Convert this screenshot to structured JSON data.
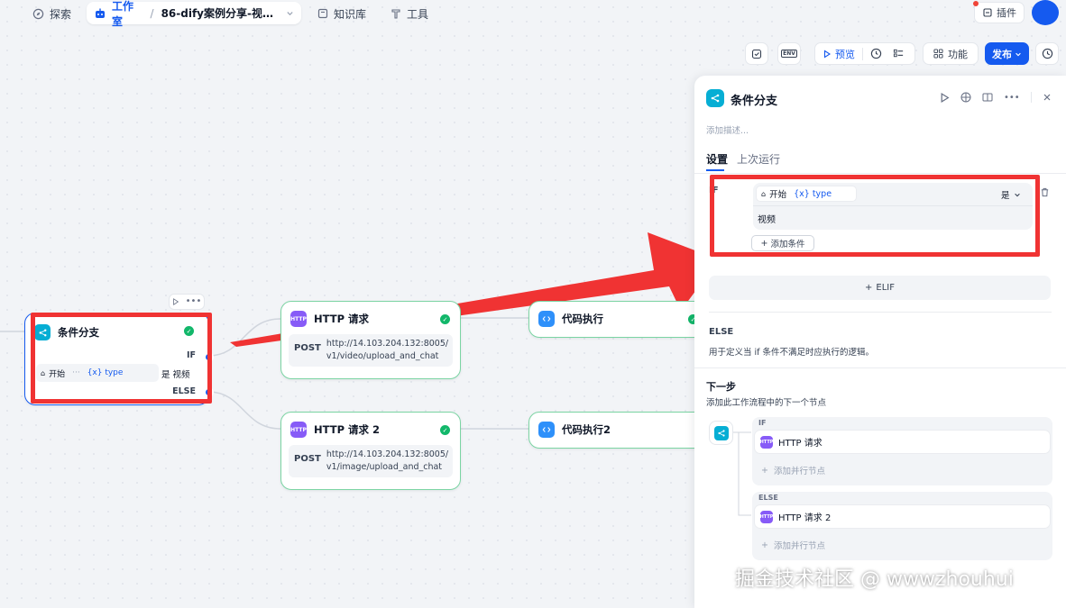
{
  "topbar": {
    "explore": "探索",
    "studio": "工作室",
    "app_name": "86-dify案例分享-视频...",
    "knowledge": "知识库",
    "tools": "工具",
    "plugins": "插件"
  },
  "toolbar": {
    "preview": "预览",
    "features": "功能",
    "publish": "发布",
    "env_label": "ENV"
  },
  "canvas": {
    "if_node": {
      "title": "条件分支",
      "if_label": "IF",
      "else_label": "ELSE",
      "cond_source": "开始",
      "cond_var": "{x} type",
      "cond_op": "是",
      "cond_value": "视频"
    },
    "http1": {
      "title": "HTTP 请求",
      "method": "POST",
      "url_line1": "http://14.103.204.132:8005/",
      "url_line2": "v1/video/upload_and_chat"
    },
    "http2": {
      "title": "HTTP 请求 2",
      "method": "POST",
      "url_line1": "http://14.103.204.132:8005/",
      "url_line2": "v1/image/upload_and_chat"
    },
    "code1": {
      "title": "代码执行"
    },
    "code2": {
      "title": "代码执行2"
    },
    "http_badge": "HTTP"
  },
  "panel": {
    "title": "条件分支",
    "desc_placeholder": "添加描述...",
    "tabs": [
      "设置",
      "上次运行"
    ],
    "if_label": "IF",
    "cond_source": "开始",
    "cond_var": "{x} type",
    "cond_op": "是",
    "cond_value": "视频",
    "add_condition": "添加条件",
    "elif": "ELIF",
    "else_title": "ELSE",
    "else_desc": "用于定义当 if 条件不满足时应执行的逻辑。",
    "next_title": "下一步",
    "next_desc": "添加此工作流程中的下一个节点",
    "branch_if": "IF",
    "branch_else": "ELSE",
    "next_if_node": "HTTP 请求",
    "next_else_node": "HTTP 请求 2",
    "add_parallel": "添加并行节点"
  },
  "watermark": "掘金技术社区 @ wwwzhouhui"
}
